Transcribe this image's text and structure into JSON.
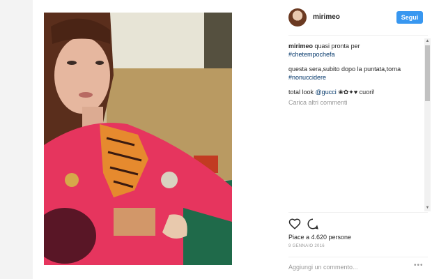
{
  "post": {
    "username": "mirimeo",
    "follow_label": "Segui",
    "caption_user": "mirimeo",
    "caption_text": "quasi pronta per",
    "caption_hashtag": "#chetempochefa",
    "comment2_text": "questa sera,subito dopo la puntata,torna",
    "comment2_hashtag": "#nonuccidere",
    "comment3_prefix": "total look",
    "comment3_mention": "@gucci",
    "comment3_suffix": "❀✿✦♥ cuori!",
    "load_more": "Carica altri commenti",
    "likes": "Piace a 4.620 persone",
    "date": "9 GENNAIO 2016",
    "add_comment_placeholder": "Aggiungi un commento...",
    "more_options": "•••"
  },
  "icons": {
    "like": "heart-icon",
    "comment": "speech-bubble-icon"
  },
  "colors": {
    "follow_button": "#3897f0",
    "link": "#003569",
    "muted": "#999999"
  }
}
